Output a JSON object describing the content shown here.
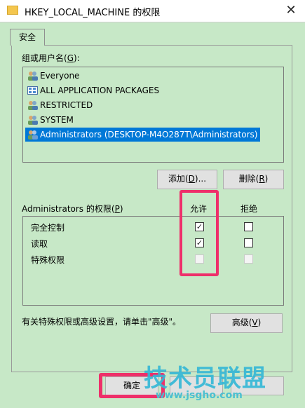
{
  "window": {
    "title": "HKEY_LOCAL_MACHINE 的权限",
    "close": "✕"
  },
  "tabs": [
    {
      "label": "安全"
    }
  ],
  "groups": {
    "label_prefix": "组或用户名(",
    "label_key": "G",
    "label_suffix": "):",
    "items": [
      {
        "name": "Everyone",
        "icon": "users-icon"
      },
      {
        "name": "ALL APPLICATION PACKAGES",
        "icon": "packages-icon"
      },
      {
        "name": "RESTRICTED",
        "icon": "users-icon"
      },
      {
        "name": "SYSTEM",
        "icon": "users-icon"
      },
      {
        "name": "Administrators (DESKTOP-M4O287T\\Administrators)",
        "icon": "users-icon",
        "selected": true
      }
    ],
    "add_prefix": "添加(",
    "add_key": "D",
    "add_suffix": ")...",
    "remove_prefix": "删除(",
    "remove_key": "R",
    "remove_suffix": ")"
  },
  "permissions": {
    "label_prefix": "Administrators 的权限(",
    "label_key": "P",
    "label_suffix": ")",
    "allow_header": "允许",
    "deny_header": "拒绝",
    "rows": [
      {
        "name": "完全控制",
        "allow": true,
        "deny": false,
        "disabled": false
      },
      {
        "name": "读取",
        "allow": true,
        "deny": false,
        "disabled": false
      },
      {
        "name": "特殊权限",
        "allow": false,
        "deny": false,
        "disabled": true
      }
    ]
  },
  "advanced": {
    "note": "有关特殊权限或高级设置，请单击\"高级\"。",
    "button_prefix": "高级(",
    "button_key": "V",
    "button_suffix": ")"
  },
  "footer": {
    "ok": "确定"
  },
  "watermark": {
    "brand": "技术员联盟",
    "url": "www.jsgho.com"
  },
  "colors": {
    "background": "#c7e8c7",
    "selection": "#0078d7",
    "highlight": "#ee2f6a",
    "watermark": "#33b7d6"
  }
}
